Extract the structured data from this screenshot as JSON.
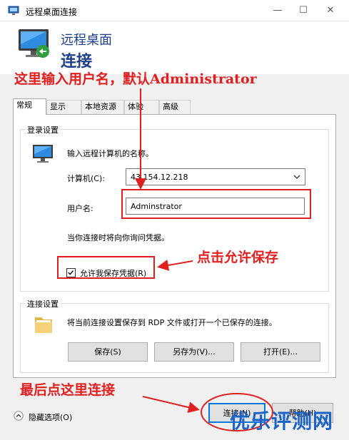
{
  "window": {
    "title": "远程桌面连接",
    "min_glyph": "—",
    "max_glyph": "☐",
    "close_glyph": "✕"
  },
  "header": {
    "line1": "远程桌面",
    "line2": "连接"
  },
  "tabs": [
    {
      "label": "常规"
    },
    {
      "label": "显示"
    },
    {
      "label": "本地资源"
    },
    {
      "label": "体验"
    },
    {
      "label": "高级"
    }
  ],
  "login": {
    "group_label": "登录设置",
    "prompt": "输入远程计算机的名称。",
    "computer_label": "计算机(C):",
    "computer_value": "43.154.12.218",
    "username_label": "用户名:",
    "username_value": "Adminstrator",
    "credential_note": "当你连接时将向你询问凭据。",
    "allow_save_label": "允许我保存凭据(R)",
    "allow_save_checked": true
  },
  "connection": {
    "group_label": "连接设置",
    "description": "将当前连接设置保存到 RDP 文件或打开一个已保存的连接。",
    "save_button": "保存(S)",
    "save_as_button": "另存为(V)...",
    "open_button": "打开(E)..."
  },
  "footer": {
    "hide_options": "隐藏选项(O)",
    "connect_button": "连接(N)",
    "help_button": "帮助(H)"
  },
  "annotations": {
    "username_hint": "这里输入用户名，默认Administrator",
    "save_hint": "点击允许保存",
    "connect_hint": "最后点这里连接",
    "color": "#e02020"
  },
  "watermark": "优乐评测网",
  "colors": {
    "header_text": "#1e3f8a",
    "accent": "#0078d7",
    "annotation": "#e02020",
    "watermark": "#1a63c8"
  },
  "icons": {
    "app": "remote-desktop-icon",
    "computer": "monitor-icon",
    "folder": "folder-icon",
    "collapse": "chevron-up-icon"
  }
}
